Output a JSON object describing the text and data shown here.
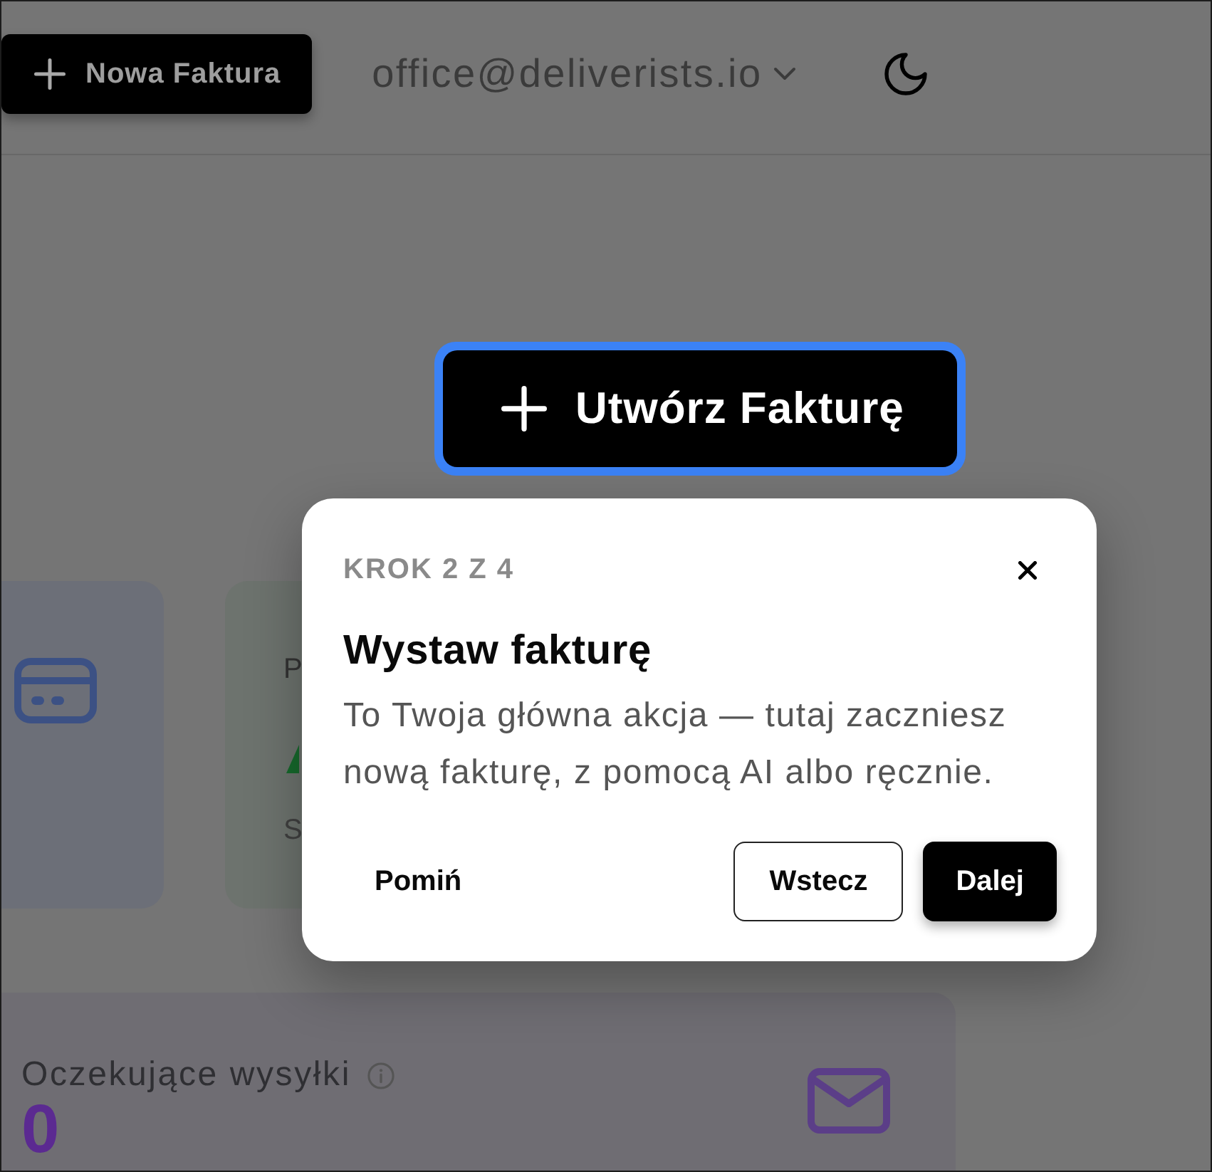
{
  "header": {
    "new_invoice_button": {
      "label": "Nowa Faktura"
    },
    "account": {
      "email": "office@deliverists.io"
    }
  },
  "create_button": {
    "label": "Utwórz Fakturę",
    "highlighted": true
  },
  "cards": [
    {
      "kind": "icon"
    },
    {
      "kind": "stat",
      "title": "P",
      "trend_up": true,
      "subtitle": "S"
    }
  ],
  "pending_card": {
    "title": "Oczekujące wysyłki",
    "value": "0"
  },
  "tour": {
    "step": "KROK 2 Z 4",
    "title": "Wystaw fakturę",
    "body": "To Twoja główna akcja — tutaj zaczniesz nową fakturę, z pomocą AI albo ręcznie.",
    "buttons": [
      {
        "label": "Pomiń",
        "kind": "text"
      },
      {
        "label": "Wstecz",
        "kind": "outline"
      },
      {
        "label": "Dalej",
        "kind": "primary"
      }
    ]
  }
}
